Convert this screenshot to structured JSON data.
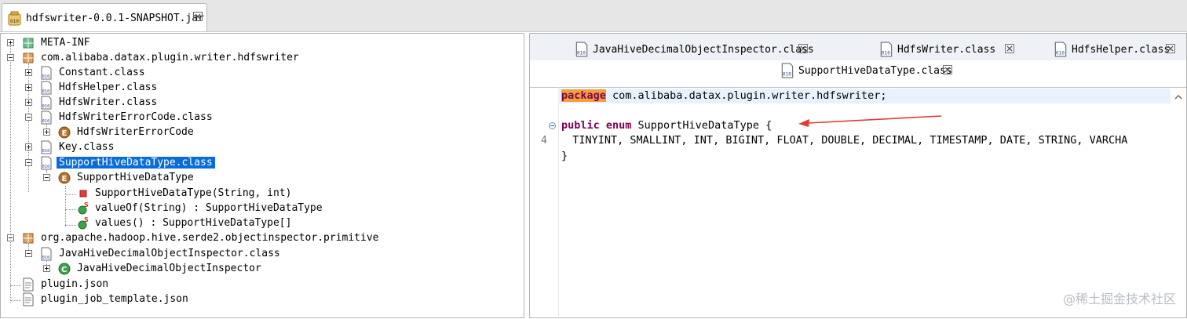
{
  "top_tab": {
    "title": "hdfswriter-0.0.1-SNAPSHOT.jar"
  },
  "tree": {
    "meta_inf": "META-INF",
    "pkg_hdfswriter": "com.alibaba.datax.plugin.writer.hdfswriter",
    "constant": "Constant.class",
    "hdfshelper": "HdfsHelper.class",
    "hdfswriter": "HdfsWriter.class",
    "errorcode_class": "HdfsWriterErrorCode.class",
    "errorcode_enum": "HdfsWriterErrorCode",
    "key": "Key.class",
    "support_class": "SupportHiveDataType.class",
    "support_enum": "SupportHiveDataType",
    "ctor": "SupportHiveDataType(String, int)",
    "valueof": "valueOf(String) : SupportHiveDataType",
    "values": "values() : SupportHiveDataType[]",
    "pkg_hive": "org.apache.hadoop.hive.serde2.objectinspector.primitive",
    "jhdoi_class": "JavaHiveDecimalObjectInspector.class",
    "jhdoi": "JavaHiveDecimalObjectInspector",
    "plugin_json": "plugin.json",
    "plugin_job": "plugin_job_template.json"
  },
  "editor_tabs": {
    "tab1": "JavaHiveDecimalObjectInspector.class",
    "tab2": "HdfsWriter.class",
    "tab3": "HdfsHelper.class",
    "active": "SupportHiveDataType.class"
  },
  "code": {
    "line1_kw": "package",
    "line1_rest": " com.alibaba.datax.plugin.writer.hdfswriter;",
    "line3_kw": "public enum",
    "line3_rest": " SupportHiveDataType {",
    "line4_no": "4",
    "line4": "  TINYINT, SMALLINT, INT, BIGINT, FLOAT, DOUBLE, DECIMAL, TIMESTAMP, DATE, STRING, VARCHA",
    "line5": "}"
  },
  "watermark": "@稀土掘金技术社区",
  "colors": {
    "selection": "#0a6cd8",
    "keyword": "#7f0055",
    "arrow": "#e53935"
  }
}
